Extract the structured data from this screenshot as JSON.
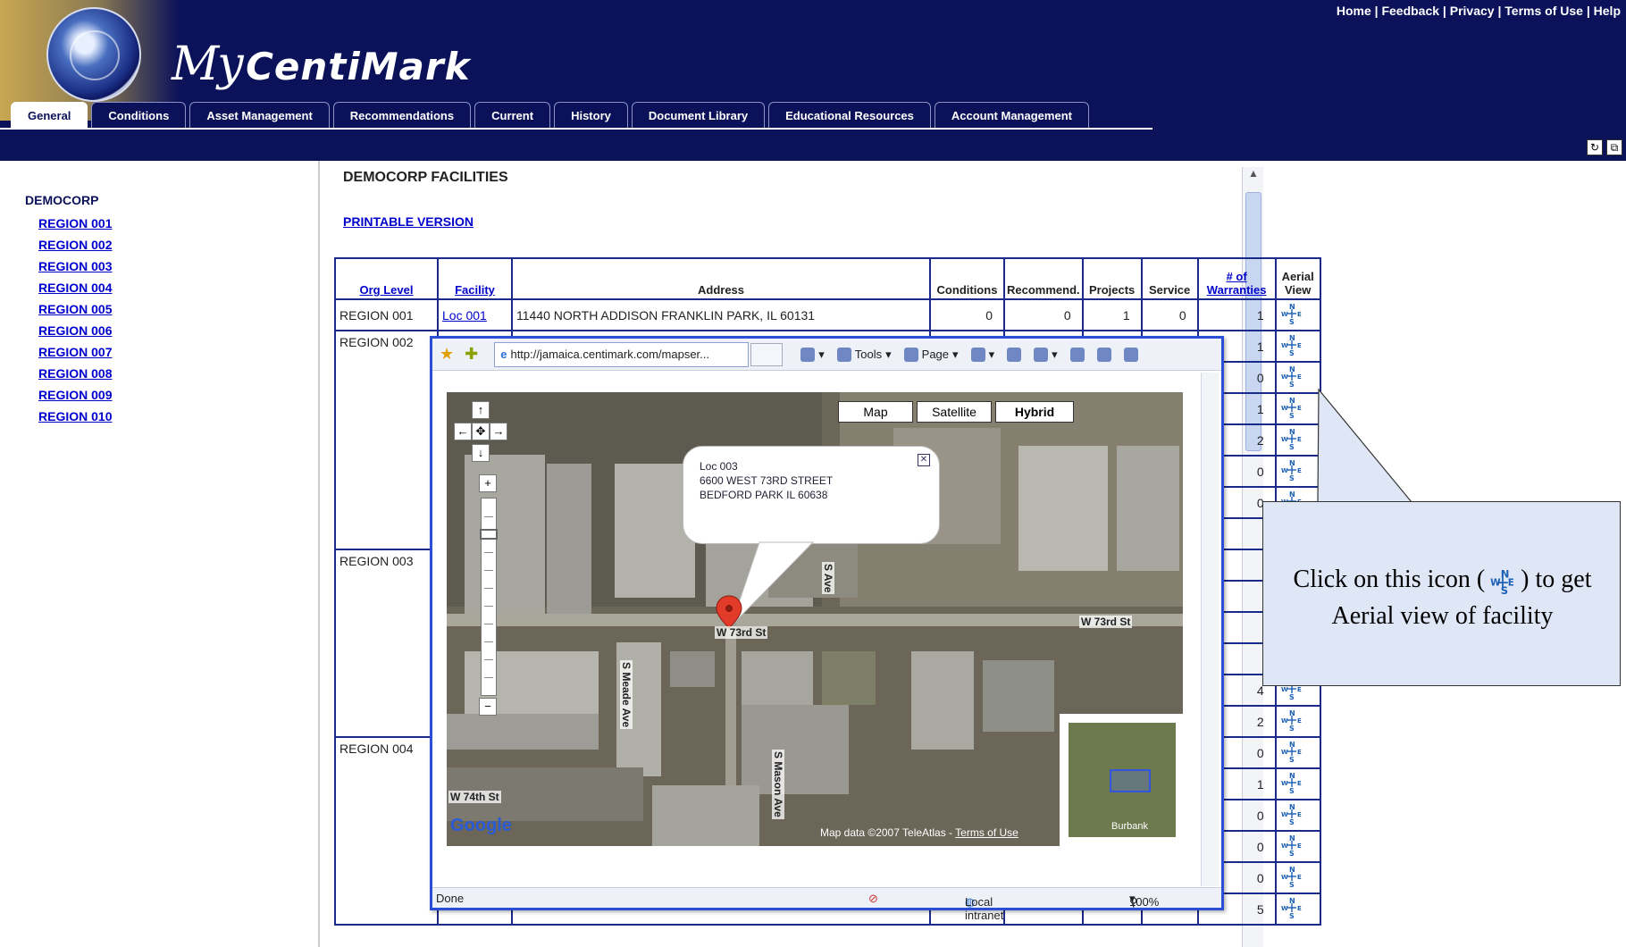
{
  "header": {
    "brand_my": "My",
    "brand_name": "CentiMark",
    "top_links": [
      "Home",
      "Feedback",
      "Privacy",
      "Terms of Use",
      "Help"
    ]
  },
  "tabs": [
    {
      "label": "General",
      "active": true
    },
    {
      "label": "Conditions"
    },
    {
      "label": "Asset Management"
    },
    {
      "label": "Recommendations"
    },
    {
      "label": "Current"
    },
    {
      "label": "History"
    },
    {
      "label": "Document Library"
    },
    {
      "label": "Educational Resources"
    },
    {
      "label": "Account Management"
    }
  ],
  "sidebar": {
    "org": "DEMOCORP",
    "regions": [
      "REGION 001",
      "REGION 002",
      "REGION 003",
      "REGION 004",
      "REGION 005",
      "REGION 006",
      "REGION 007",
      "REGION 008",
      "REGION 009",
      "REGION 010"
    ]
  },
  "main": {
    "title": "DEMOCORP FACILITIES",
    "printable": "PRINTABLE VERSION"
  },
  "table": {
    "headers": {
      "org_level": "Org Level",
      "facility": "Facility",
      "address": "Address",
      "conditions": "Conditions",
      "recommend": "Recommend.",
      "projects": "Projects",
      "service": "Service",
      "warranties": "# of Warranties",
      "aerial": "Aerial View"
    },
    "row1": {
      "org": "REGION 001",
      "facility": "Loc 001",
      "address": "11440 NORTH ADDISON FRANKLIN PARK, IL 60131",
      "conditions": "0",
      "recommend": "0",
      "projects": "1",
      "service": "0",
      "warranties": "1"
    },
    "region_labels": {
      "r2": "REGION 002",
      "r3": "REGION 003",
      "r4": "REGION 004"
    },
    "warranty_values": [
      "1",
      "0",
      "1",
      "2",
      "0",
      "0",
      "",
      "",
      "",
      "",
      "",
      "4",
      "2",
      "0",
      "1",
      "0",
      "0",
      "0",
      "5"
    ]
  },
  "popup": {
    "url": "http://jamaica.centimark.com/mapser...",
    "tools": "Tools",
    "page": "Page",
    "map_types": [
      "Map",
      "Satellite",
      "Hybrid"
    ],
    "bubble_lines": [
      "Loc 003",
      "6600 WEST 73RD STREET",
      "BEDFORD PARK IL 60638"
    ],
    "roads": {
      "w73_left": "W 73rd St",
      "w73_right": "W 73rd St",
      "w74": "W 74th St",
      "meade": "S Meade Ave",
      "mason": "S Mason Ave",
      "upper": "S Ave"
    },
    "google": "Google",
    "map_data": "Map data ©2007 TeleAtlas -",
    "terms": "Terms of Use",
    "overview_label": "Burbank",
    "status_done": "Done",
    "status_zone": "Local intranet",
    "status_zoom": "100%"
  },
  "callout": {
    "text_before": "Click on this icon (",
    "text_after": ") to get Aerial view of facility"
  },
  "colors": {
    "header_bg": "#0b1259",
    "link": "#0000cc",
    "table_border": "#1a2a8a",
    "callout_bg": "#dfe6f6"
  }
}
